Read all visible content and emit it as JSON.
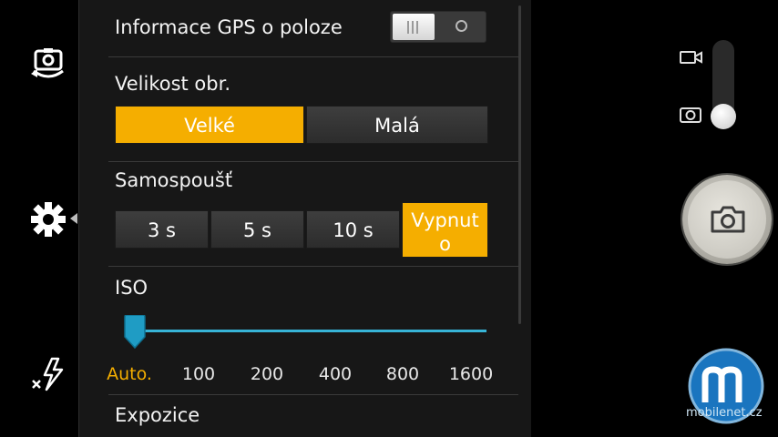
{
  "left_bar": {
    "icons": [
      "switch-camera-icon",
      "settings-gear-icon",
      "flash-off-icon"
    ]
  },
  "settings": {
    "gps": {
      "label": "Informace GPS o poloze",
      "enabled": false
    },
    "image_size": {
      "label": "Velikost obr.",
      "options": [
        "Velké",
        "Malá"
      ],
      "selected": "Velké"
    },
    "self_timer": {
      "label": "Samospoušť",
      "options": [
        "3 s",
        "5 s",
        "10 s",
        "Vypnut o"
      ],
      "selected": "Vypnut o"
    },
    "iso": {
      "label": "ISO",
      "options": [
        "Auto.",
        "100",
        "200",
        "400",
        "800",
        "1600"
      ],
      "selected": "Auto."
    },
    "exposure": {
      "label": "Expozice"
    }
  },
  "right_controls": {
    "mode_switch": {
      "modes": [
        "video-camera-icon",
        "still-camera-icon"
      ],
      "selected": "still-camera-icon"
    },
    "shutter_icon": "camera-icon"
  },
  "watermark": {
    "text": "mobilenet.cz",
    "letter": "m"
  },
  "colors": {
    "accent": "#f5ae00",
    "slider": "#37b4d6",
    "panel_bg": "#171717",
    "button_bg": "#353535"
  }
}
